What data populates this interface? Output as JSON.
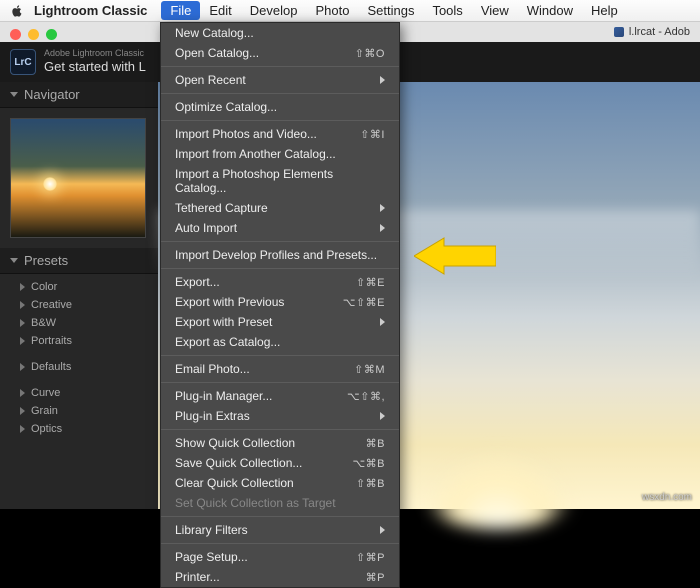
{
  "menubar": {
    "app_name": "Lightroom Classic",
    "items": [
      "File",
      "Edit",
      "Develop",
      "Photo",
      "Settings",
      "Tools",
      "View",
      "Window",
      "Help"
    ],
    "active_index": 0
  },
  "doc_title": "l.lrcat - Adob",
  "header": {
    "sup": "Adobe Lightroom Classic",
    "title": "Get started with L"
  },
  "sidebar": {
    "navigator": "Navigator",
    "presets_label": "Presets",
    "groups1": [
      "Color",
      "Creative",
      "B&W",
      "Portraits"
    ],
    "defaults": "Defaults",
    "groups2": [
      "Curve",
      "Grain",
      "Optics"
    ]
  },
  "file_menu": {
    "groups": [
      [
        {
          "label": "New Catalog..."
        },
        {
          "label": "Open Catalog...",
          "shortcut": "⇧⌘O"
        }
      ],
      [
        {
          "label": "Open Recent",
          "submenu": true
        }
      ],
      [
        {
          "label": "Optimize Catalog..."
        }
      ],
      [
        {
          "label": "Import Photos and Video...",
          "shortcut": "⇧⌘I"
        },
        {
          "label": "Import from Another Catalog..."
        },
        {
          "label": "Import a Photoshop Elements Catalog..."
        },
        {
          "label": "Tethered Capture",
          "submenu": true
        },
        {
          "label": "Auto Import",
          "submenu": true
        }
      ],
      [
        {
          "label": "Import Develop Profiles and Presets..."
        }
      ],
      [
        {
          "label": "Export...",
          "shortcut": "⇧⌘E"
        },
        {
          "label": "Export with Previous",
          "shortcut": "⌥⇧⌘E"
        },
        {
          "label": "Export with Preset",
          "submenu": true
        },
        {
          "label": "Export as Catalog..."
        }
      ],
      [
        {
          "label": "Email Photo...",
          "shortcut": "⇧⌘M"
        }
      ],
      [
        {
          "label": "Plug-in Manager...",
          "shortcut": "⌥⇧⌘,"
        },
        {
          "label": "Plug-in Extras",
          "submenu": true
        }
      ],
      [
        {
          "label": "Show Quick Collection",
          "shortcut": "⌘B"
        },
        {
          "label": "Save Quick Collection...",
          "shortcut": "⌥⌘B"
        },
        {
          "label": "Clear Quick Collection",
          "shortcut": "⇧⌘B"
        },
        {
          "label": "Set Quick Collection as Target",
          "disabled": true
        }
      ],
      [
        {
          "label": "Library Filters",
          "submenu": true
        }
      ],
      [
        {
          "label": "Page Setup...",
          "shortcut": "⇧⌘P"
        },
        {
          "label": "Printer...",
          "shortcut": "⌘P"
        }
      ]
    ]
  },
  "watermark": "wsxdn.com"
}
